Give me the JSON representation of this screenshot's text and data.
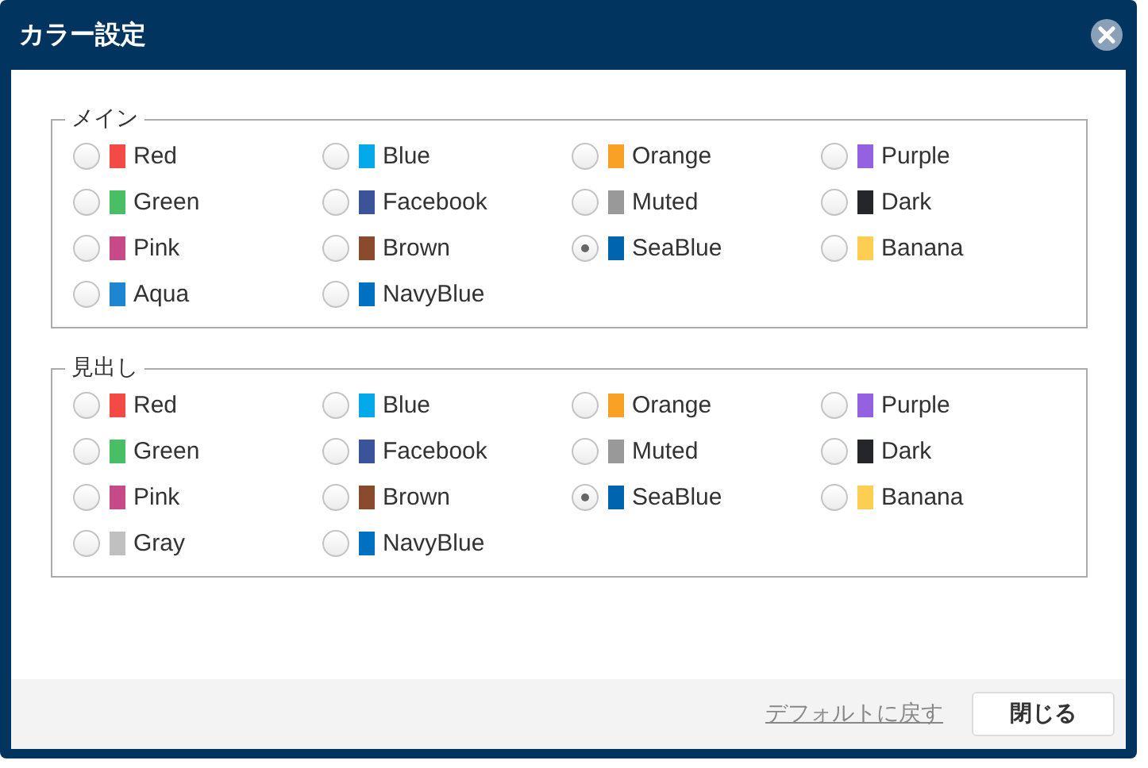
{
  "window": {
    "title": "カラー設定"
  },
  "groups": [
    {
      "legend": "メイン",
      "options": [
        {
          "label": "Red",
          "color": "#f44a45",
          "selected": false
        },
        {
          "label": "Blue",
          "color": "#03a9e8",
          "selected": false
        },
        {
          "label": "Orange",
          "color": "#f8a125",
          "selected": false
        },
        {
          "label": "Purple",
          "color": "#9462e0",
          "selected": false
        },
        {
          "label": "Green",
          "color": "#48be65",
          "selected": false
        },
        {
          "label": "Facebook",
          "color": "#3b5499",
          "selected": false
        },
        {
          "label": "Muted",
          "color": "#999999",
          "selected": false
        },
        {
          "label": "Dark",
          "color": "#24262a",
          "selected": false
        },
        {
          "label": "Pink",
          "color": "#c54a87",
          "selected": false
        },
        {
          "label": "Brown",
          "color": "#8a4a2d",
          "selected": false
        },
        {
          "label": "SeaBlue",
          "color": "#0064ae",
          "selected": true
        },
        {
          "label": "Banana",
          "color": "#fdce52",
          "selected": false
        },
        {
          "label": "Aqua",
          "color": "#1e85d0",
          "selected": false
        },
        {
          "label": "NavyBlue",
          "color": "#0070c2",
          "selected": false
        }
      ]
    },
    {
      "legend": "見出し",
      "options": [
        {
          "label": "Red",
          "color": "#f44a45",
          "selected": false
        },
        {
          "label": "Blue",
          "color": "#03a9e8",
          "selected": false
        },
        {
          "label": "Orange",
          "color": "#f8a125",
          "selected": false
        },
        {
          "label": "Purple",
          "color": "#9462e0",
          "selected": false
        },
        {
          "label": "Green",
          "color": "#48be65",
          "selected": false
        },
        {
          "label": "Facebook",
          "color": "#3b5499",
          "selected": false
        },
        {
          "label": "Muted",
          "color": "#999999",
          "selected": false
        },
        {
          "label": "Dark",
          "color": "#24262a",
          "selected": false
        },
        {
          "label": "Pink",
          "color": "#c54a87",
          "selected": false
        },
        {
          "label": "Brown",
          "color": "#8a4a2d",
          "selected": false
        },
        {
          "label": "SeaBlue",
          "color": "#0064ae",
          "selected": true
        },
        {
          "label": "Banana",
          "color": "#fdce52",
          "selected": false
        },
        {
          "label": "Gray",
          "color": "#c0c0c0",
          "selected": false
        },
        {
          "label": "NavyBlue",
          "color": "#0070c2",
          "selected": false
        }
      ]
    }
  ],
  "footer": {
    "reset_link": "デフォルトに戻す",
    "close_button": "閉じる"
  }
}
